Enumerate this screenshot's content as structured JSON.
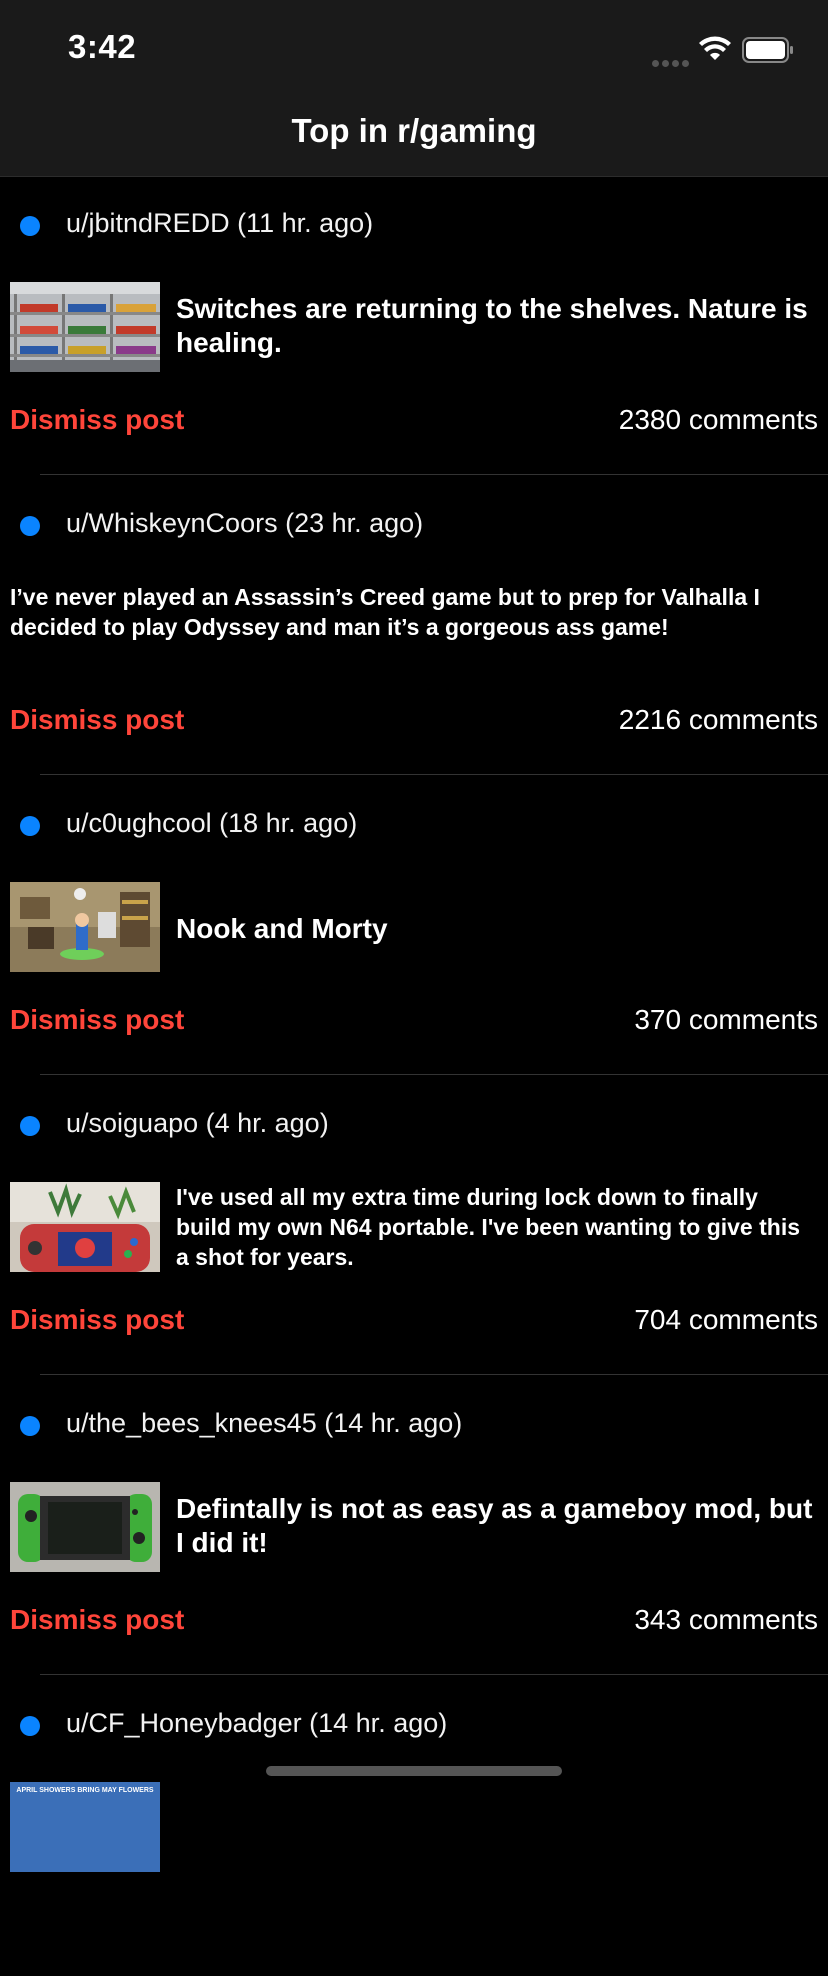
{
  "status_bar": {
    "time": "3:42",
    "icons": [
      "signal-dots-icon",
      "wifi-icon",
      "battery-icon"
    ]
  },
  "nav": {
    "title": "Top in r/gaming"
  },
  "colors": {
    "accent": "#0a84ff",
    "dismiss": "#ff453a",
    "background": "#000000",
    "bar": "#1a1a1a"
  },
  "posts": [
    {
      "author_line": "u/jbitndREDD (11 hr. ago)",
      "title": "Switches are returning to the shelves. Nature is healing.",
      "has_thumbnail": true,
      "dismiss_label": "Dismiss post",
      "comments": "2380 comments"
    },
    {
      "author_line": "u/WhiskeynCoors (23 hr. ago)",
      "title": "I’ve never played an Assassin’s Creed game but to prep for Valhalla I decided to play Odyssey and man it’s a gorgeous ass game!",
      "has_thumbnail": false,
      "dismiss_label": "Dismiss post",
      "comments": "2216 comments"
    },
    {
      "author_line": "u/c0ughcool (18 hr. ago)",
      "title": "Nook and Morty",
      "has_thumbnail": true,
      "dismiss_label": "Dismiss post",
      "comments": "370 comments"
    },
    {
      "author_line": "u/soiguapo (4 hr. ago)",
      "title": "I've used all my extra time during lock down to finally build my own N64 portable. I've been wanting to give this a shot for years.",
      "has_thumbnail": true,
      "dismiss_label": "Dismiss post",
      "comments": "704 comments"
    },
    {
      "author_line": "u/the_bees_knees45 (14 hr. ago)",
      "title": "Defintally is not as easy as a gameboy mod, but I did it!",
      "has_thumbnail": true,
      "dismiss_label": "Dismiss post",
      "comments": "343 comments"
    },
    {
      "author_line": "u/CF_Honeybadger (14 hr. ago)",
      "thumbnail_caption": "APRIL SHOWERS BRING MAY FLOWERS",
      "has_thumbnail": true
    }
  ]
}
